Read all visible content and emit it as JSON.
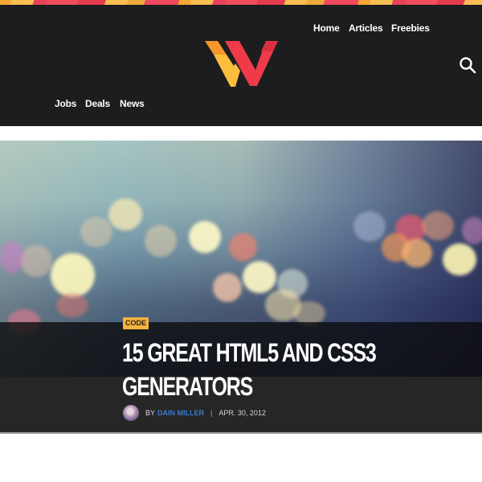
{
  "header": {
    "top_nav": [
      {
        "label": "Home"
      },
      {
        "label": "Articles"
      },
      {
        "label": "Freebies"
      }
    ],
    "bottom_nav": [
      {
        "label": "Jobs"
      },
      {
        "label": "Deals"
      },
      {
        "label": "News"
      }
    ],
    "logo_icon": "w-logo-icon",
    "search_icon": "search-icon"
  },
  "colors": {
    "header_bg": "#1b1d1e",
    "logo_orange": "#f6962b",
    "logo_yellow": "#fbbd3c",
    "logo_red": "#ee3a49",
    "badge_bg": "#f5b342",
    "author_link": "#3b7bd0",
    "title_band_bg": "#262626"
  },
  "article": {
    "category": "CODE",
    "title_lines": [
      "15 GREAT HTML5 AND CSS3",
      "GENERATORS"
    ],
    "by_label": "BY",
    "author": "DAIN MILLER",
    "separator": "|",
    "date": "APR. 30, 2012"
  }
}
